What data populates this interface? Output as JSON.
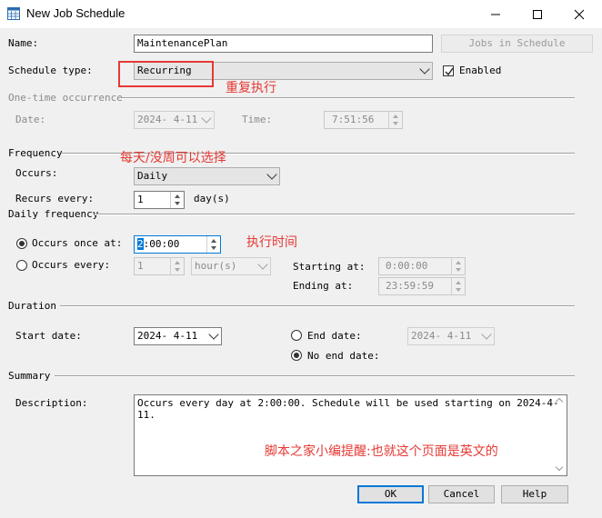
{
  "window": {
    "title": "New Job Schedule",
    "controls": [
      "minimize",
      "maximize",
      "close"
    ]
  },
  "name": {
    "label": "Name:",
    "value": "MaintenancePlan",
    "jobs_button": "Jobs in Schedule"
  },
  "schedule_type": {
    "label": "Schedule type:",
    "value": "Recurring",
    "enabled_label": "Enabled",
    "enabled": true
  },
  "one_time": {
    "section": "One-time occurrence",
    "date_label": "Date:",
    "date_value": "2024- 4-11",
    "time_label": "Time:",
    "time_value": "7:51:56"
  },
  "frequency": {
    "section": "Frequency",
    "occurs_label": "Occurs:",
    "occurs_value": "Daily",
    "recurs_label": "Recurs every:",
    "recurs_value": "1",
    "recurs_unit": "day(s)"
  },
  "daily": {
    "section": "Daily frequency",
    "once_label": "Occurs once at:",
    "once_value_sel": "2",
    "once_value_rest": ":00:00",
    "every_label": "Occurs every:",
    "every_value": "1",
    "every_unit": "hour(s)",
    "start_label": "Starting at:",
    "start_value": "0:00:00",
    "end_label": "Ending at:",
    "end_value": "23:59:59"
  },
  "duration": {
    "section": "Duration",
    "start_label": "Start date:",
    "start_value": "2024- 4-11",
    "end_label": "End date:",
    "end_value": "2024- 4-11",
    "no_end_label": "No end date:"
  },
  "summary": {
    "section": "Summary",
    "description_label": "Description:",
    "description": "Occurs every day at 2:00:00. Schedule will be used starting on 2024-4-11."
  },
  "buttons": {
    "ok": "OK",
    "cancel": "Cancel",
    "help": "Help"
  },
  "annotations": {
    "recurring": "重复执行",
    "frequency": "每天/没周可以选择",
    "exec_time": "执行时间",
    "note": "脚本之家小编提醒:也就这个页面是英文的"
  },
  "colors": {
    "annotation": "#e53935",
    "accent": "#0078d7"
  }
}
